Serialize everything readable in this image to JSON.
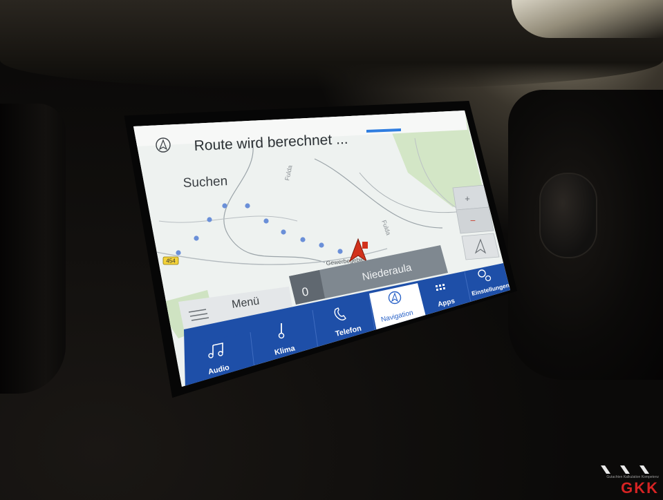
{
  "navigation_screen": {
    "route_status": "Route wird berechnet ...",
    "search_label": "Suchen",
    "menu_label": "Menü",
    "destination_label": "Niederaula",
    "eta_prefix": "0",
    "zoom_in_label": "+",
    "zoom_out_label": "−",
    "map_labels": {
      "road_badge": "454",
      "river_upper": "Fulda",
      "river_right": "Fulda",
      "street": "Gewerbegebiet"
    }
  },
  "bottom_bar": {
    "items": [
      {
        "id": "audio",
        "label": "Audio",
        "icon": "music-note-icon"
      },
      {
        "id": "klima",
        "label": "Klima",
        "icon": "thermometer-icon"
      },
      {
        "id": "telefon",
        "label": "Telefon",
        "icon": "phone-icon"
      },
      {
        "id": "navigation",
        "label": "Navigation",
        "icon": "navigation-compass-icon",
        "active": true
      },
      {
        "id": "apps",
        "label": "Apps",
        "icon": "apps-grid-icon"
      },
      {
        "id": "einstellungen",
        "label": "Einstellungen",
        "icon": "settings-gears-icon"
      }
    ]
  },
  "colors": {
    "bar_blue": "#1e4fa8",
    "bar_blue_dark": "#173f8c",
    "active_tab": "#ffffff",
    "active_text": "#2a63c8",
    "route_dot": "#6a8fd8",
    "map_bg": "#eef2f0",
    "park_green": "#d3e6c6",
    "header_bg": "#f7f8f7",
    "panel_grey": "#7f8890",
    "vehicle_red": "#d2321c",
    "badge_yellow": "#f3d23a"
  },
  "watermark": {
    "tagline": "Gutachten Kalkulation Kompetenz",
    "letters": "GKK"
  }
}
